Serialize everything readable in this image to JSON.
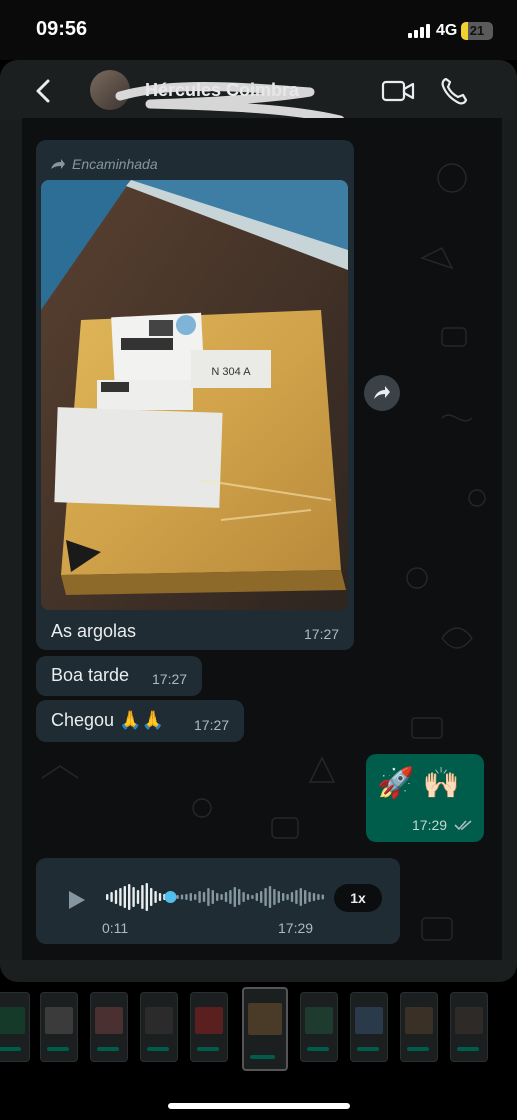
{
  "status_bar": {
    "time": "09:56",
    "network": "4G",
    "battery_percent": 21,
    "battery_label": "21"
  },
  "header": {
    "contact_name": "Hércules Coimbra",
    "icons": [
      "back-icon",
      "video-call-icon",
      "voice-call-icon"
    ]
  },
  "messages": {
    "forwarded_label": "Encaminhada",
    "photo_caption": "As argolas",
    "photo_time": "17:27",
    "label_text": "N 304 A",
    "msg2_text": "Boa tarde",
    "msg2_time": "17:27",
    "msg3_text": "Chegou 🙏🙏",
    "msg3_time": "17:27",
    "out_emoji": "🚀 🙌🏻",
    "out_time": "17:29",
    "voice_duration": "0:11",
    "voice_time": "17:29",
    "voice_speed": "1x",
    "voice_progress": 0.5
  },
  "colors": {
    "incoming_bubble": "#1f2c33",
    "outgoing_bubble": "#005c4b",
    "voice_progress": "#53bdeb",
    "ticks": "#aebac1"
  },
  "thumbnails_count": 10
}
